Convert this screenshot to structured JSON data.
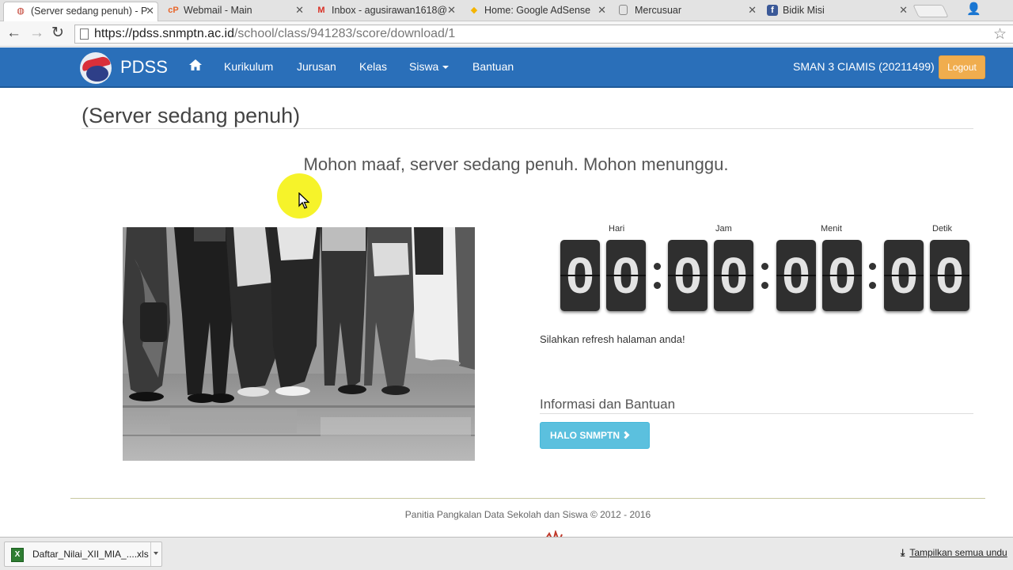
{
  "browser": {
    "tabs": [
      {
        "title": "(Server sedang penuh) - P",
        "favicon": "pdss-icon",
        "active": true
      },
      {
        "title": "Webmail - Main",
        "favicon": "cpanel-icon",
        "active": false
      },
      {
        "title": "Inbox - agusirawan1618@",
        "favicon": "gmail-icon",
        "active": false
      },
      {
        "title": "Home: Google AdSense",
        "favicon": "adsense-icon",
        "active": false
      },
      {
        "title": "Mercusuar",
        "favicon": "page-icon",
        "active": false
      },
      {
        "title": "Bidik Misi",
        "favicon": "facebook-icon",
        "active": false
      }
    ],
    "url_host": "https://pdss.snmptn.ac.id",
    "url_path": "/school/class/941283/score/download/1"
  },
  "nav": {
    "brand": "PDSS",
    "links": [
      "Kurikulum",
      "Jurusan",
      "Kelas",
      "Siswa",
      "Bantuan"
    ],
    "school": "SMAN 3 CIAMIS (20211499)",
    "logout": "Logout"
  },
  "content": {
    "title": "(Server sedang penuh)",
    "message": "Mohon maaf, server sedang penuh. Mohon menunggu.",
    "refresh_text": "Silahkan refresh halaman anda!",
    "info_title": "Informasi dan Bantuan",
    "help_button": "HALO SNMPTN"
  },
  "countdown": {
    "labels": [
      "Hari",
      "Jam",
      "Menit",
      "Detik"
    ],
    "digits": [
      "0",
      "0",
      "0",
      "0",
      "0",
      "0",
      "0",
      "0"
    ]
  },
  "footer": {
    "text": "Panitia Pangkalan Data Sekolah dan Siswa © 2012 - 2016"
  },
  "download_shelf": {
    "file": "Daftar_Nilai_XII_MIA_....xls",
    "show_all": "Tampilkan semua undu"
  },
  "colors": {
    "navbar": "#2a6fb9",
    "logout": "#f0ad4e",
    "help_button": "#5bc0de",
    "digit_bg": "#2f2f2f"
  }
}
